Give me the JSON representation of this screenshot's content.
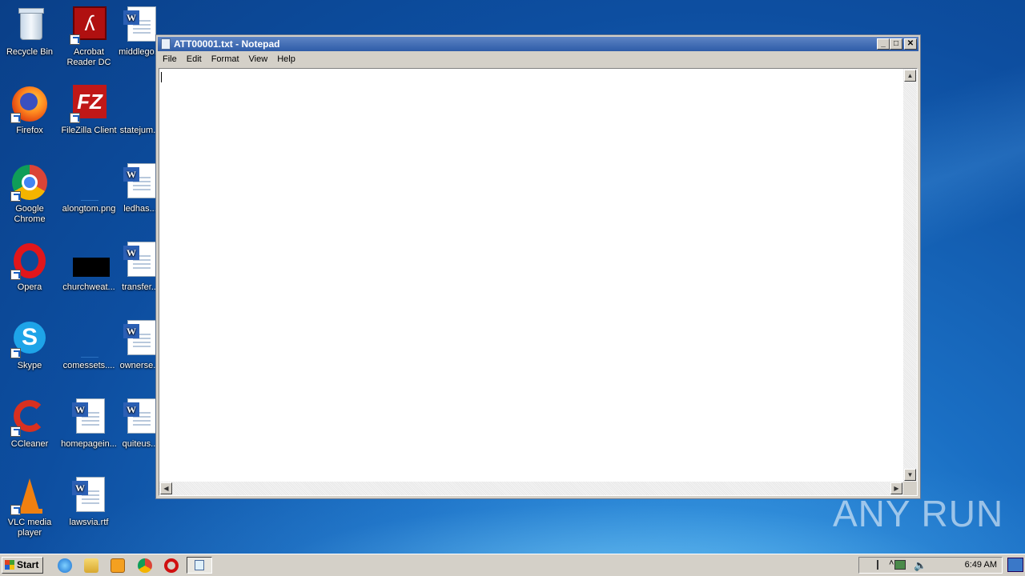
{
  "desktop": {
    "icons": [
      {
        "label": "Recycle Bin"
      },
      {
        "label": "Acrobat Reader DC"
      },
      {
        "label": "middlego..."
      },
      {
        "label": "Firefox"
      },
      {
        "label": "FileZilla Client"
      },
      {
        "label": "statejum..."
      },
      {
        "label": "Google Chrome"
      },
      {
        "label": "alongtom.png"
      },
      {
        "label": "ledhas..."
      },
      {
        "label": "Opera"
      },
      {
        "label": "churchweat..."
      },
      {
        "label": "transfer..."
      },
      {
        "label": "Skype"
      },
      {
        "label": "comessets...."
      },
      {
        "label": "ownerse..."
      },
      {
        "label": "CCleaner"
      },
      {
        "label": "homepagein..."
      },
      {
        "label": "quiteus..."
      },
      {
        "label": "VLC media player"
      },
      {
        "label": "lawsvia.rtf"
      }
    ]
  },
  "window": {
    "title": "ATT00001.txt - Notepad",
    "menu": [
      "File",
      "Edit",
      "Format",
      "View",
      "Help"
    ],
    "content": ""
  },
  "taskbar": {
    "start_label": "Start",
    "clock": "6:49 AM"
  },
  "watermark": "ANY RUN"
}
